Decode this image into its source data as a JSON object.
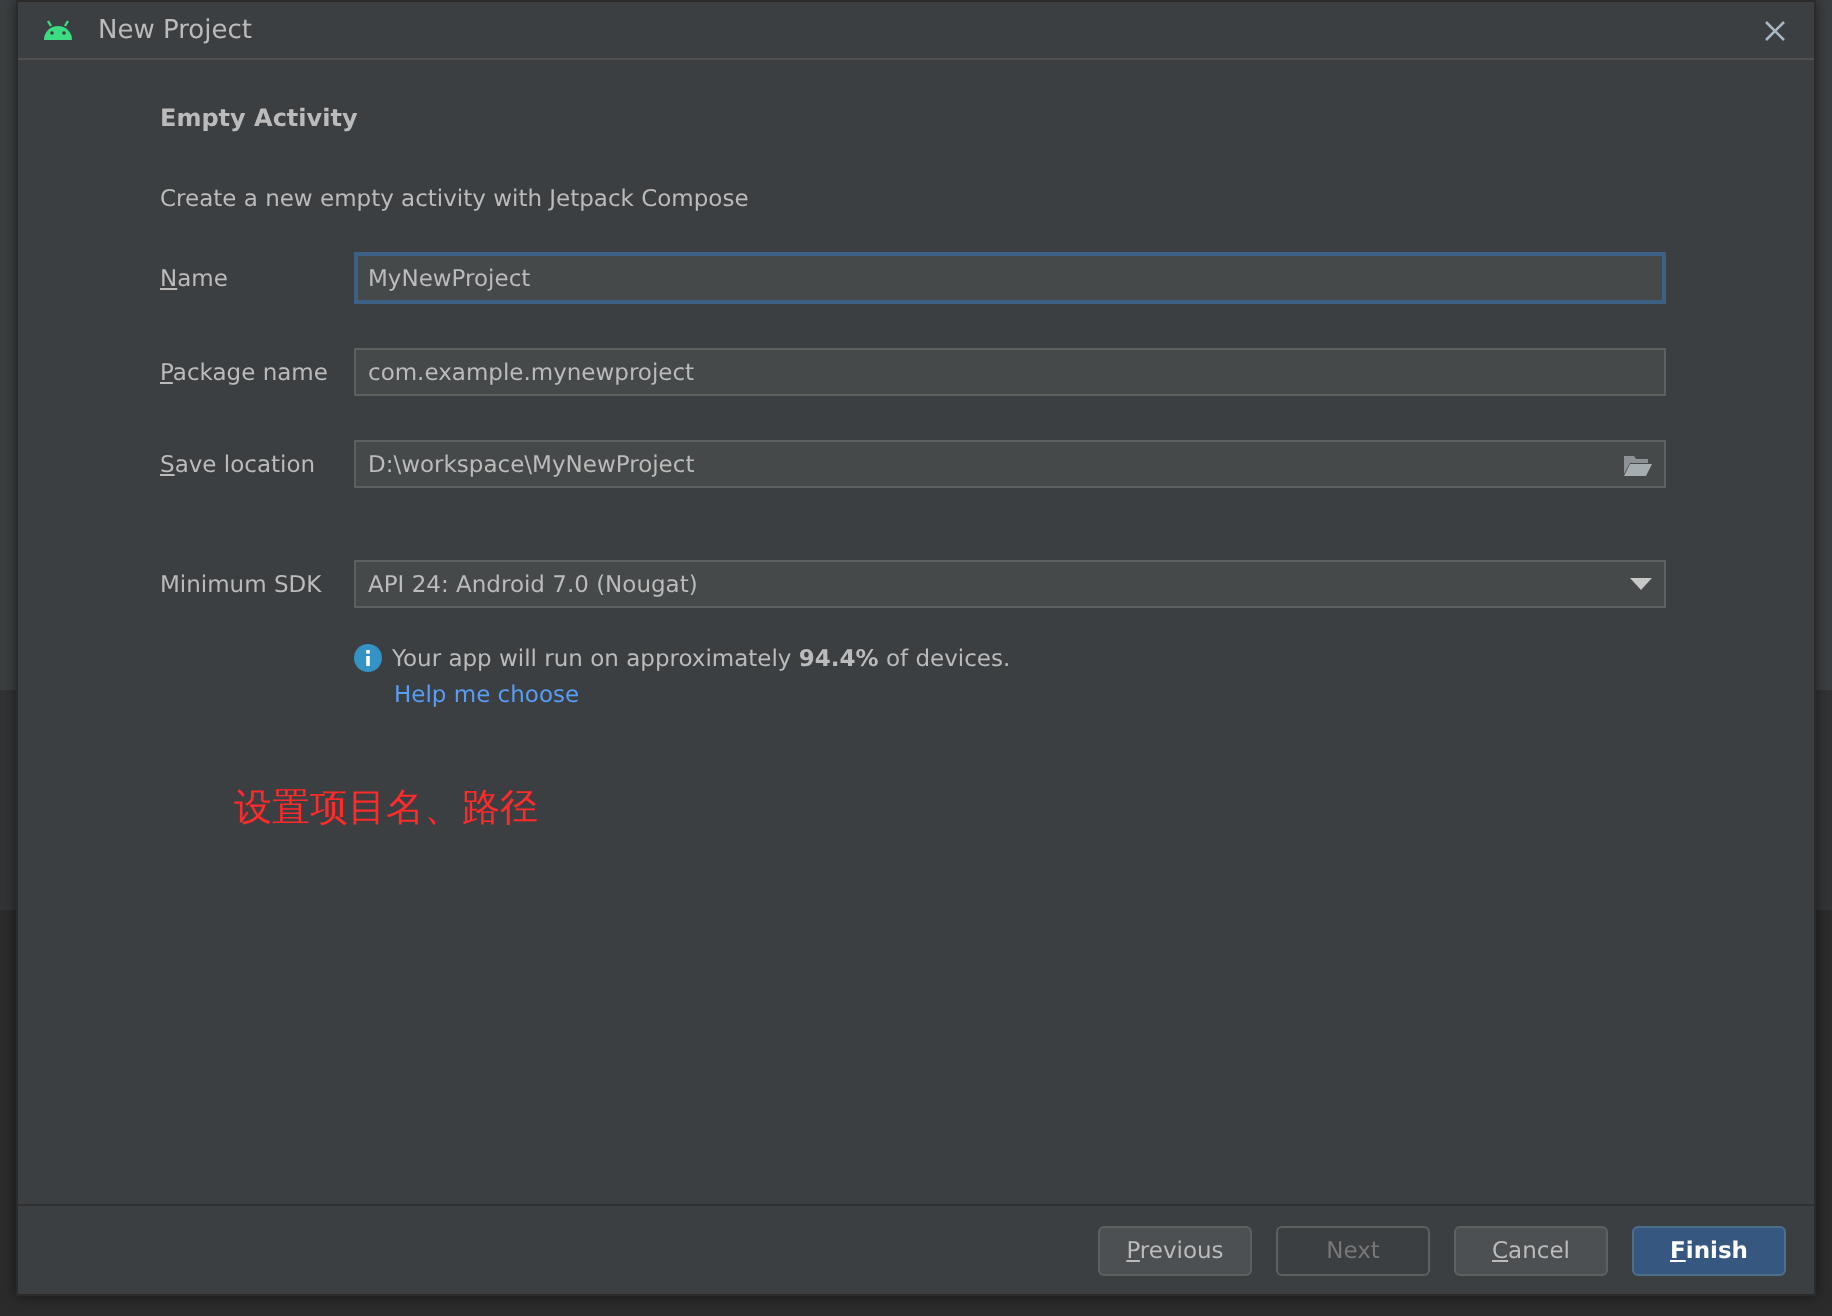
{
  "window": {
    "title": "New Project"
  },
  "heading": "Empty Activity",
  "description": "Create a new empty activity with Jetpack Compose",
  "fields": [
    {
      "kind": "text",
      "label": "Name",
      "mnemonic": true,
      "value": "MyNewProject",
      "focused": true
    },
    {
      "kind": "text",
      "label": "Package name",
      "mnemonic": true,
      "value": "com.example.mynewproject",
      "focused": false
    },
    {
      "kind": "folder",
      "label": "Save location",
      "mnemonic": true,
      "value": "D:\\workspace\\MyNewProject",
      "focused": false
    },
    {
      "kind": "dropdown",
      "label": "Minimum SDK",
      "mnemonic": false,
      "value": "API 24: Android 7.0 (Nougat)",
      "focused": false
    }
  ],
  "info": {
    "text": "Your app will run on approximately **94.4%** of devices.",
    "link": "Help me choose"
  },
  "annotation": "设置项目名、路径",
  "buttons": [
    {
      "label": "Previous",
      "mnemonic": true,
      "disabled": false,
      "primary": false
    },
    {
      "label": "Next",
      "mnemonic": false,
      "disabled": true,
      "primary": false
    },
    {
      "label": "Cancel",
      "mnemonic": true,
      "disabled": false,
      "primary": false
    },
    {
      "label": "Finish",
      "mnemonic": true,
      "disabled": false,
      "primary": true
    }
  ]
}
